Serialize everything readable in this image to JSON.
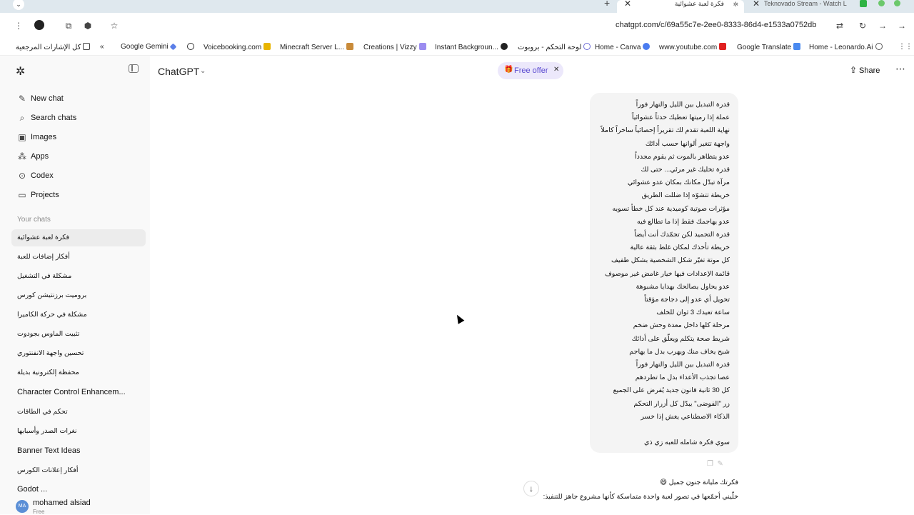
{
  "browser": {
    "tabs": [
      {
        "title": "فكرة لعبة عشوائية",
        "active": true
      },
      {
        "title": "Teknovado Stream - Watch L",
        "active": false
      }
    ],
    "url": "chatgpt.com/c/69a55c7e-2ee0-8333-86d4-e1533a0752db",
    "bookmarks": [
      "كل الإشارات المرجعية",
      "Google Gemini",
      "Voicebooking.com",
      "Minecraft Server L...",
      "Creations | Vizzy",
      "Instant Backgroun...",
      "لوحة التحكم - بروبوت",
      "Home - Canva",
      "www.youtube.com",
      "Google Translate",
      "Home - Leonardo.Ai"
    ]
  },
  "sidebar": {
    "nav": [
      {
        "label": "New chat",
        "icon": "edit-icon"
      },
      {
        "label": "Search chats",
        "icon": "search-icon"
      },
      {
        "label": "Images",
        "icon": "image-icon"
      },
      {
        "label": "Apps",
        "icon": "apps-icon"
      },
      {
        "label": "Codex",
        "icon": "codex-icon"
      },
      {
        "label": "Projects",
        "icon": "folder-icon"
      }
    ],
    "section_label": "Your chats",
    "chats": [
      "فكرة لعبة عشوائية",
      "أفكار إضافات للعبة",
      "مشكلة في التشغيل",
      "بروميت برزنتيشن كورس",
      "مشكلة في حركة الكاميرا",
      "تثبيت الماوس بجودوت",
      "تحسين واجهة الانفنتوري",
      "محفظة إلكترونية بديلة",
      "Character Control Enhancem...",
      "تحكم في الطاقات",
      "نغرات الصدر وأسبابها",
      "Banner Text Ideas",
      "أفكار إعلانات الكورس",
      "Godot ..."
    ],
    "user": {
      "initials": "MA",
      "name": "mohamed alsiad",
      "plan": "Free"
    }
  },
  "header": {
    "model": "ChatGPT",
    "offer_label": "Free offer",
    "share_label": "Share"
  },
  "conversation": {
    "user_message_lines": [
      "قدرة التبديل بين الليل والنهار فوراً",
      "عملة إذا رميتها تعطيك حدثاً عشوائياً",
      "نهاية اللعبة تقدم لك تقريراً إحصائياً ساخراً كاملاً",
      "واجهة تتغير ألوانها حسب أدائك",
      "عدو يتظاهر بالموت ثم يقوم مجدداً",
      "قدرة تخليك غير مرئي... حتى لك",
      "مرآة تبدّل مكانك بمكان عدو عشوائي",
      "خريطة تتشوّه إذا ضللت الطريق",
      "مؤثرات صوتية كوميدية عند كل خطأ تسويه",
      "عدو يهاجمك فقط إذا ما تطالع فيه",
      "قدرة التجميد لكن تجمّدك أنت أيضاً",
      "خريطة تأخذك لمكان غلط بثقة عالية",
      "كل موتة تغيّر شكل الشخصية بشكل طفيف",
      "قائمة الإعدادات فيها خيار غامض غير موصوف",
      "عدو يحاول يصالحك بهدايا مشبوهة",
      "تحويل أي عدو إلى دجاجة مؤقتاً",
      "ساعة تعيدك 3 ثوان للخلف",
      "مرحلة كلها داخل معدة وحش ضخم",
      "شريط صحة يتكلم ويعلّق على أدائك",
      "شبح يخاف منك ويهرب بدل ما يهاجم",
      "قدرة التبديل بين الليل والنهار فوراً",
      "عصا تجذب الأعداء بدل ما تطردهم",
      "كل 30 ثانية قانون جديد يُفرض على الجميع",
      "زر \"الفوضى\" يبدّل كل أزرار التحكم",
      "الذكاء الاصطناعي يغش إذا خسر",
      "",
      "سوي فكره شامله للعبه زي ذي"
    ],
    "assistant_reply_lines": [
      "فكرتك مليانة جنون جميل 😄",
      "خلّيني أجمّعها في تصور لعبة واحدة متماسكة كأنها مشروع جاهز للتنفيذ:"
    ]
  }
}
